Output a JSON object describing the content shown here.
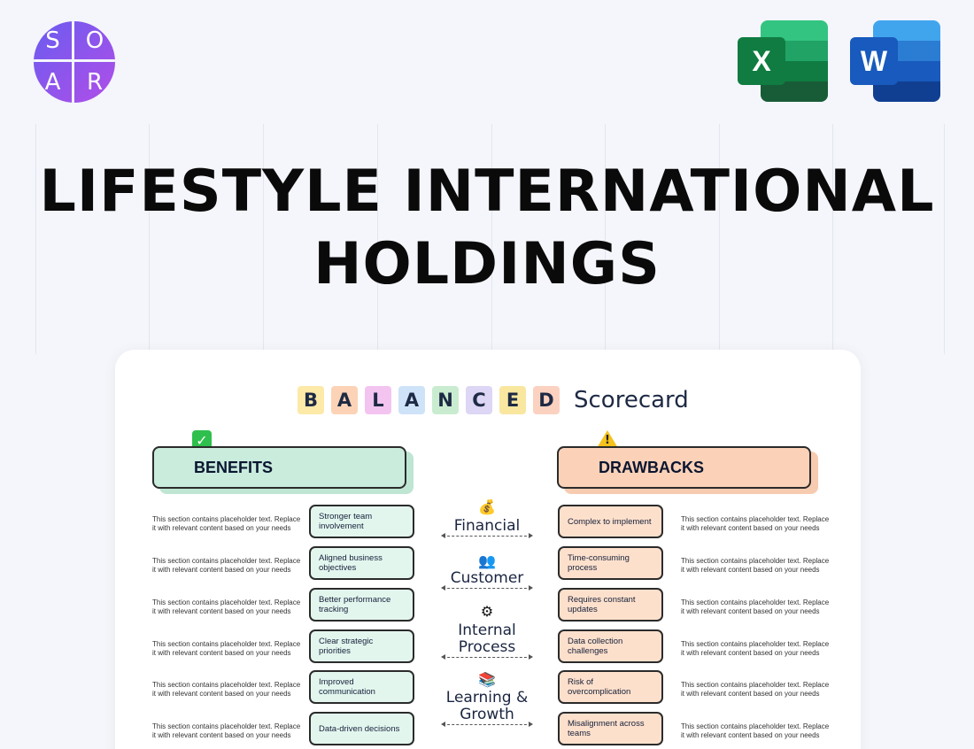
{
  "logo": {
    "letters": [
      "S",
      "O",
      "A",
      "R"
    ]
  },
  "apps": {
    "excel": {
      "letter": "X",
      "colors": [
        "#33c481",
        "#21a366",
        "#107c41",
        "#185c37"
      ],
      "badge": "#107c41"
    },
    "word": {
      "letter": "W",
      "colors": [
        "#41a5ee",
        "#2b7cd3",
        "#185abd",
        "#103f91"
      ],
      "badge": "#185abd"
    }
  },
  "title": {
    "line1": "LIFESTYLE INTERNATIONAL",
    "line2": "HOLDINGS"
  },
  "scorecard": {
    "letters": [
      "B",
      "A",
      "L",
      "A",
      "N",
      "C",
      "E",
      "D"
    ],
    "letter_colors": [
      "#fde9a8",
      "#fcd3b6",
      "#f4c4f0",
      "#cfe3f8",
      "#c9ecd0",
      "#ddd6f5",
      "#f9e7a0",
      "#fbd2c0"
    ],
    "word": "Scorecard"
  },
  "benefits": {
    "header": "BENEFITS",
    "items": [
      "Stronger team involvement",
      "Aligned business objectives",
      "Better performance tracking",
      "Clear strategic priorities",
      "Improved communication",
      "Data-driven decisions"
    ]
  },
  "drawbacks": {
    "header": "DRAWBACKS",
    "items": [
      "Complex to implement",
      "Time-consuming process",
      "Requires constant updates",
      "Data collection challenges",
      "Risk of overcomplication",
      "Misalignment across teams"
    ]
  },
  "placeholder_text": "This section contains placeholder text. Replace it with relevant content based on your needs",
  "perspectives": [
    {
      "icon": "money-bag-icon",
      "glyph": "💰",
      "label": "Financial"
    },
    {
      "icon": "people-icon",
      "glyph": "👥",
      "label": "Customer"
    },
    {
      "icon": "gear-icon",
      "glyph": "⚙",
      "label": "Internal Process"
    },
    {
      "icon": "books-icon",
      "glyph": "📚",
      "label": "Learning & Growth"
    }
  ]
}
